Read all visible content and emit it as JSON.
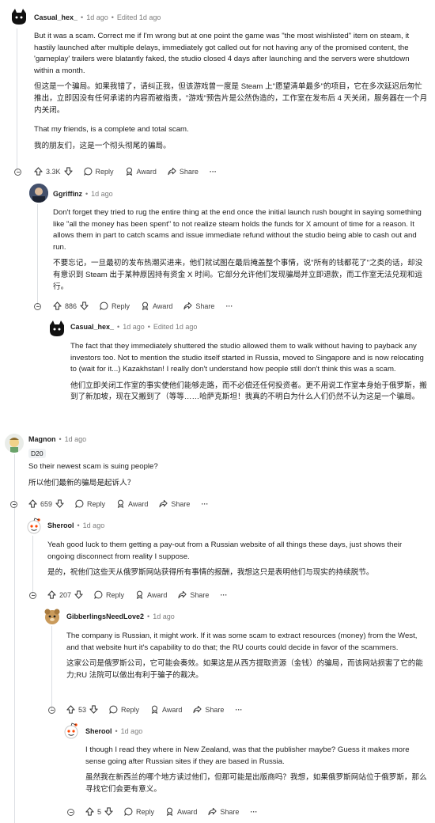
{
  "comments": [
    {
      "author": "Casual_hex_",
      "time": "1d ago",
      "edited": "Edited 1d ago",
      "paragraphs": [
        "But it was a scam. Correct me if I'm wrong but at one point the game was \"the most wishlisted\" item on steam, it hastily launched after multiple delays, immediately got called out for not having any of the promised content, the 'gameplay' trailers were blatantly faked, the studio closed 4 days after launching and the servers were shutdown within a month.",
        "但这是一个骗局。如果我错了，请纠正我，但该游戏曾一度是 Steam 上\"愿望清单最多\"的项目，它在多次延迟后匆忙推出，立即因没有任何承诺的内容而被指责，\"游戏\"预告片是公然伪造的，工作室在发布后 4 天关闭，服务器在一个月内关闭。",
        "That my friends, is a complete and total scam.",
        "我的朋友们，这是一个彻头彻尾的骗局。"
      ],
      "votes": "3.3K"
    },
    {
      "author": "Ggriffinz",
      "time": "1d ago",
      "paragraphs": [
        "Don't forget they tried to rug the entire thing at the end once the initial launch rush bought in saying something like \"all the money has been spent\" to not realize steam holds the funds for X amount of time for a reason. It allows them in part to catch scams and issue immediate refund without the studio being able to cash out and run.",
        "不要忘记，一旦最初的发布热潮买进来，他们就试图在最后掩盖整个事情，说\"所有的钱都花了\"之类的话，却没有意识到 Steam 出于某种原因持有资金 X 时间。它部分允许他们发现骗局并立即退款，而工作室无法兑现和运行。"
      ],
      "votes": "886"
    },
    {
      "author": "Casual_hex_",
      "time": "1d ago",
      "edited": "Edited 1d ago",
      "paragraphs": [
        "The fact that they immediately shuttered the studio allowed them to walk without having to payback any investors too. Not to mention the studio itself started in Russia, moved to Singapore and is now relocating to (wait for it...) Kazakhstan! I really don't understand how people still don't think this was a scam.",
        "他们立即关闭工作室的事实使他们能够走路，而不必偿还任何投资者。更不用说工作室本身始于俄罗斯，搬到了新加坡，现在又搬到了（等等……哈萨克斯坦！我真的不明白为什么人们仍然不认为这是一个骗局。"
      ]
    },
    {
      "author": "Magnon",
      "time": "1d ago",
      "flair": "D20",
      "paragraphs": [
        "So their newest scam is suing people?",
        "所以他们最新的骗局是起诉人？"
      ],
      "votes": "659"
    },
    {
      "author": "Sherool",
      "time": "1d ago",
      "paragraphs": [
        "Yeah good luck to them getting a pay-out from a Russian website of all things these days, just shows their ongoing disconnect from reality I suppose.",
        "是的，祝他们这些天从俄罗斯网站获得所有事情的报酬，我想这只是表明他们与现实的持续脱节。"
      ],
      "votes": "207"
    },
    {
      "author": "GibberlingsNeedLove2",
      "time": "1d ago",
      "paragraphs": [
        "The company is Russian, it might work. If it was some scam to extract resources (money) from the West, and that website hurt it's capability to do that; the RU courts could decide in favor of the scammers.",
        "这家公司是俄罗斯公司，它可能会奏效。如果这是从西方提取资源（金钱）的骗局，而该网站损害了它的能力;RU 法院可以做出有利于骗子的裁决。"
      ],
      "votes": "53"
    },
    {
      "author": "Sherool",
      "time": "1d ago",
      "paragraphs": [
        "I though I read they where in New Zealand, was that the publisher maybe? Guess it makes more sense going after Russian sites if they are based in Russia.",
        "虽然我在新西兰的哪个地方读过他们，但那可能是出版商吗？我想，如果俄罗斯网站位于俄罗斯，那么寻找它们会更有意义。"
      ],
      "votes": "5"
    }
  ],
  "labels": {
    "reply": "Reply",
    "award": "Award",
    "share": "Share",
    "more": "···",
    "sep": "•"
  }
}
